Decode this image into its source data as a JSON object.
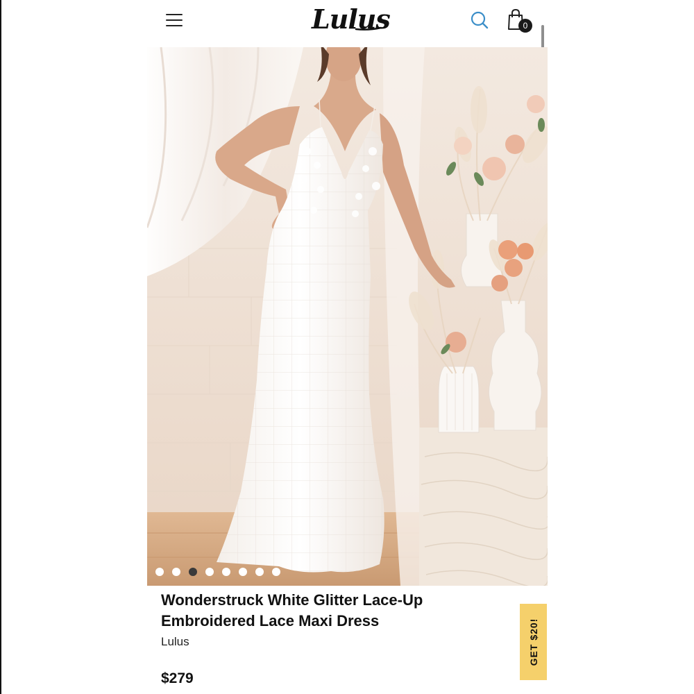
{
  "header": {
    "logo": "Lulus",
    "cart_count": "0"
  },
  "product": {
    "title": "Wonderstruck White Glitter Lace-Up Embroidered Lace Maxi Dress",
    "brand": "Lulus",
    "price": "$279"
  },
  "gallery": {
    "image_count": 8,
    "active_index": 2
  },
  "promo": {
    "label": "GET $20!",
    "color": "#f5d06b"
  },
  "icons": [
    "hamburger-menu-icon",
    "search-icon",
    "shopping-bag-icon"
  ],
  "colors": {
    "search_icon": "#3b8ec8",
    "background": "#ffffff",
    "text": "#111111"
  }
}
